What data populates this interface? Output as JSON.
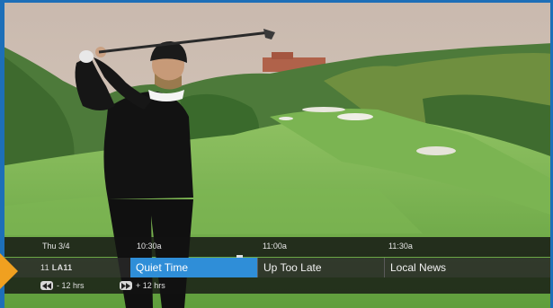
{
  "guide": {
    "date": "Thu 3/4",
    "times": [
      "10:30a",
      "11:00a",
      "11:30a"
    ],
    "channel": {
      "number": "11",
      "name": "LA11"
    },
    "programs": [
      {
        "title": "Quiet Time",
        "selected": true
      },
      {
        "title": "Up Too Late",
        "selected": false
      },
      {
        "title": "Local News",
        "selected": false
      }
    ],
    "nav": {
      "back": {
        "label": "- 12 hrs",
        "icon": "rewind-icon"
      },
      "forward": {
        "label": "+ 12 hrs",
        "icon": "fast-forward-icon"
      }
    }
  },
  "colors": {
    "accent": "#2f8ed8",
    "frame": "#1d6fb8",
    "pointer": "#f0a020"
  }
}
